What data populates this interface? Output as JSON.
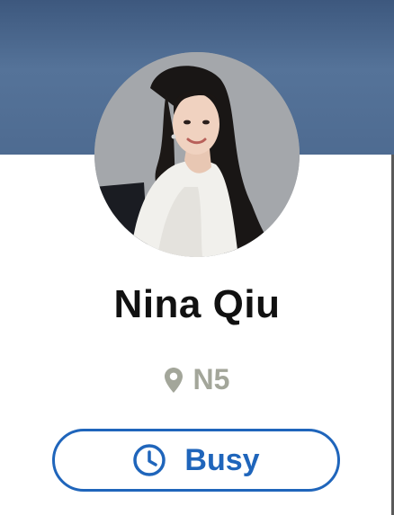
{
  "profile": {
    "name": "Nina Qiu",
    "location": "N5",
    "location_icon": "map-pin-icon",
    "avatar_alt": "Nina Qiu"
  },
  "status": {
    "label": "Busy",
    "icon": "clock-icon",
    "accent_color": "#1f65bb"
  },
  "theme": {
    "banner_color": "#4e6b91",
    "location_color": "#a3a69a",
    "name_color": "#111111"
  }
}
